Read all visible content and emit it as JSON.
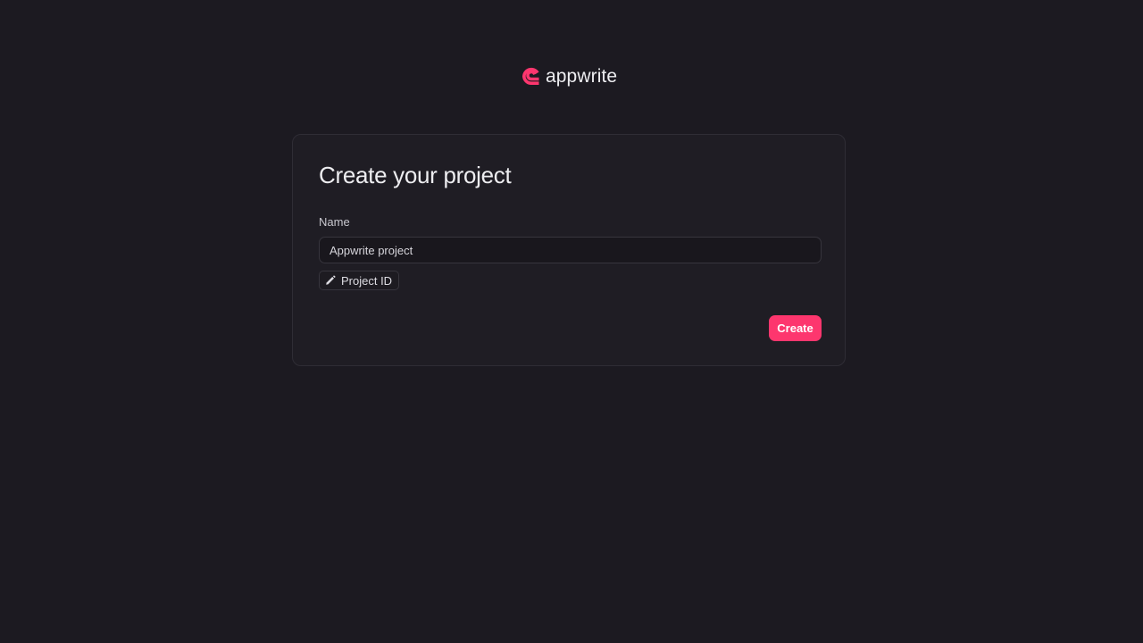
{
  "brand": {
    "name": "appwrite",
    "logo_icon": "appwrite-logo-icon",
    "accent_color": "#fd366e"
  },
  "card": {
    "title": "Create your project",
    "name_label": "Name",
    "name_value": "Appwrite project",
    "project_id_label": "Project ID",
    "project_id_icon": "pencil-icon",
    "create_label": "Create"
  },
  "colors": {
    "background": "#1c1a21",
    "card_background": "#1f1d24",
    "border": "#2f2d35",
    "primary_button": "#fd366e"
  }
}
